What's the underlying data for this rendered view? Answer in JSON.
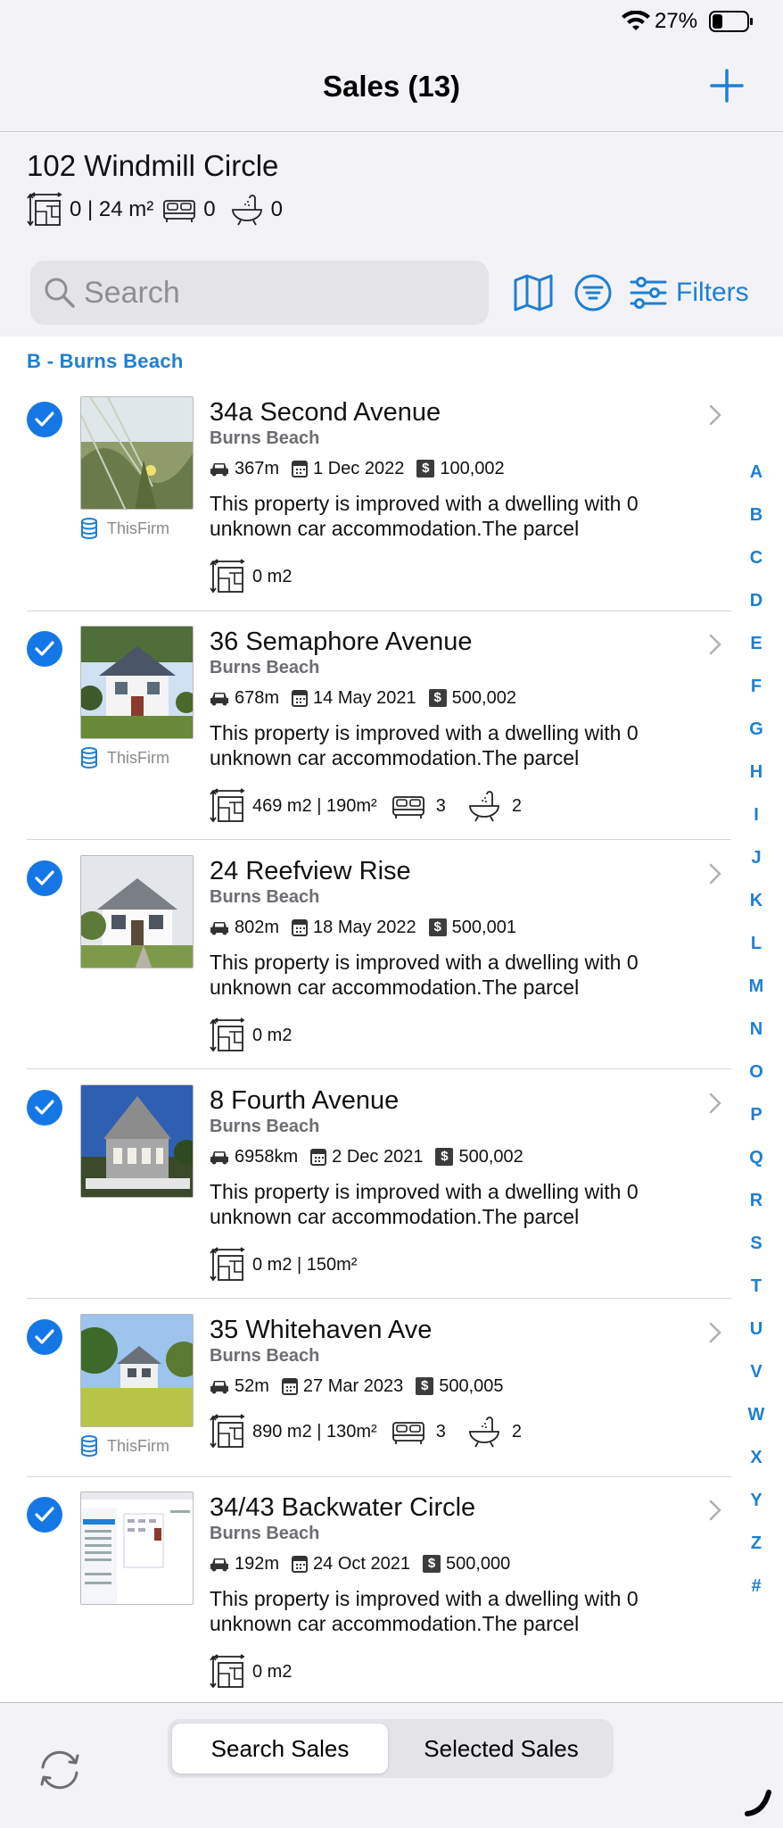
{
  "status": {
    "battery_pct": "27%"
  },
  "nav": {
    "title": "Sales (13)"
  },
  "selected_property": {
    "title": "102 Windmill Circle",
    "area": "0 | 24 m²",
    "beds": "0",
    "baths": "0"
  },
  "search": {
    "placeholder": "Search",
    "filters_label": "Filters"
  },
  "section": {
    "label": "B - Burns Beach"
  },
  "rows": [
    {
      "title": "34a Second Avenue",
      "suburb": "Burns Beach",
      "distance": "367m",
      "date": "1 Dec 2022",
      "price": "100,002",
      "desc": "This property is improved with a dwelling with 0 unknown car accommodation.The parcel",
      "area": "0 m2",
      "firm": "ThisFirm"
    },
    {
      "title": "36 Semaphore Avenue",
      "suburb": "Burns Beach",
      "distance": "678m",
      "date": "14 May 2021",
      "price": "500,002",
      "desc": "This property is improved with a dwelling with 0 unknown car accommodation.The parcel",
      "area": "469 m2 | 190m²",
      "beds": "3",
      "baths": "2",
      "firm": "ThisFirm"
    },
    {
      "title": "24 Reefview Rise",
      "suburb": "Burns Beach",
      "distance": "802m",
      "date": "18 May 2022",
      "price": "500,001",
      "desc": "This property is improved with a dwelling with 0 unknown car accommodation.The parcel",
      "area": "0 m2"
    },
    {
      "title": "8 Fourth Avenue",
      "suburb": "Burns Beach",
      "distance": "6958km",
      "date": "2 Dec 2021",
      "price": "500,002",
      "desc": "This property is improved with a dwelling with 0 unknown car accommodation.The parcel",
      "area": "0 m2 | 150m²"
    },
    {
      "title": "35 Whitehaven Ave",
      "suburb": "Burns Beach",
      "distance": "52m",
      "date": "27 Mar 2023",
      "price": "500,005",
      "area": "890 m2 | 130m²",
      "beds": "3",
      "baths": "2",
      "firm": "ThisFirm"
    },
    {
      "title": "34/43 Backwater Circle",
      "suburb": "Burns Beach",
      "distance": "192m",
      "date": "24 Oct 2021",
      "price": "500,000",
      "desc": "This property is improved with a dwelling with 0 unknown car accommodation.The parcel",
      "area": "0 m2"
    }
  ],
  "alphabet": [
    "A",
    "B",
    "C",
    "D",
    "E",
    "F",
    "G",
    "H",
    "I",
    "J",
    "K",
    "L",
    "M",
    "N",
    "O",
    "P",
    "Q",
    "R",
    "S",
    "T",
    "U",
    "V",
    "W",
    "X",
    "Y",
    "Z",
    "#"
  ],
  "bottom": {
    "search_sales": "Search Sales",
    "selected_sales": "Selected Sales"
  },
  "colors": {
    "accent": "#1e7fd3",
    "check": "#1577e6",
    "background": "#f2f2f7"
  },
  "icons": [
    "wifi-icon",
    "battery-icon",
    "plus-icon",
    "floor-area-icon",
    "bed-icon",
    "bath-icon",
    "search-icon",
    "map-icon",
    "sort-icon",
    "filters-icon",
    "checkmark-icon",
    "database-icon",
    "car-icon",
    "calendar-icon",
    "dollar-icon",
    "chevron-right-icon",
    "refresh-icon"
  ]
}
